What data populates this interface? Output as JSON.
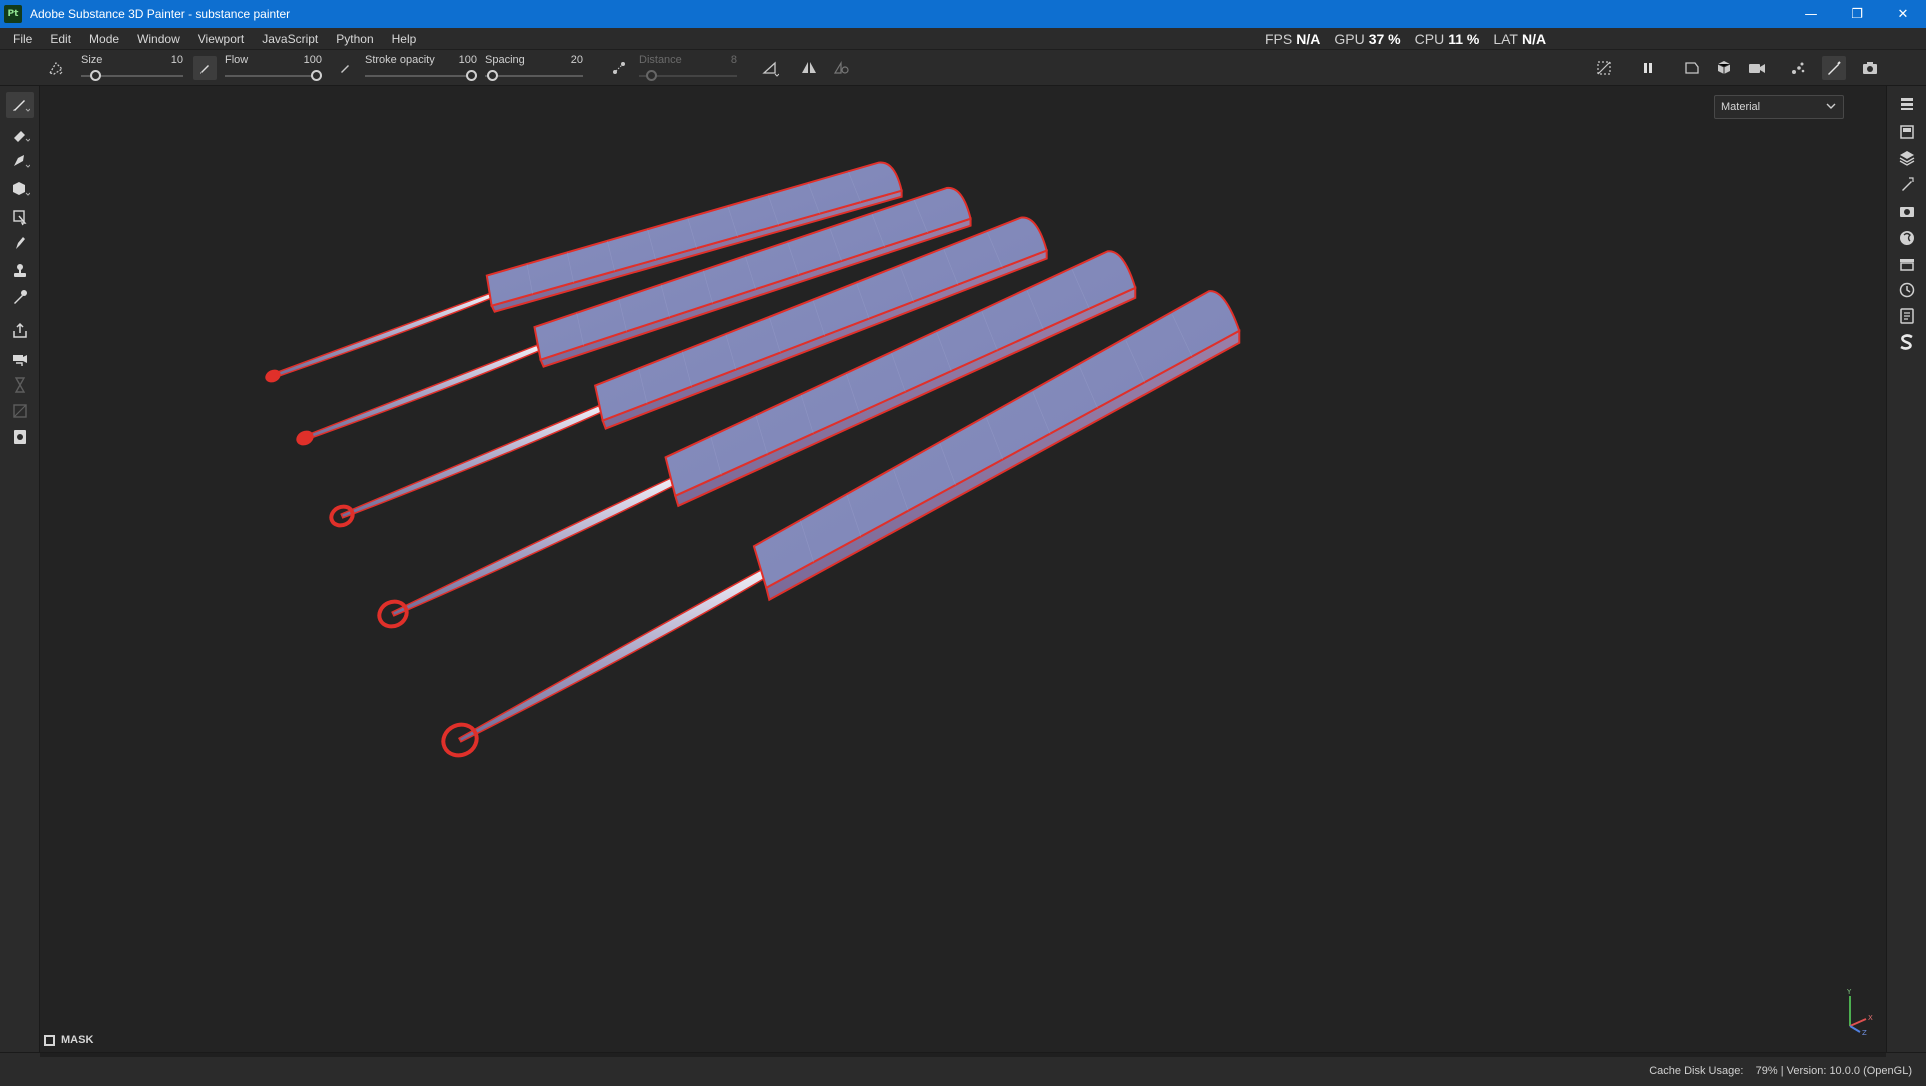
{
  "window": {
    "app_badge": "Pt",
    "title": "Adobe Substance 3D Painter - substance painter",
    "controls": {
      "minimize": "—",
      "restore": "❐",
      "close": "✕"
    }
  },
  "menu": {
    "items": [
      "File",
      "Edit",
      "Mode",
      "Window",
      "Viewport",
      "JavaScript",
      "Python",
      "Help"
    ]
  },
  "perf": {
    "fps_label": "FPS",
    "fps_value": "N/A",
    "gpu_label": "GPU",
    "gpu_value": "37 %",
    "cpu_label": "CPU",
    "cpu_value": "11 %",
    "lat_label": "LAT",
    "lat_value": "N/A"
  },
  "toolbar": {
    "size": {
      "label": "Size",
      "value": "10",
      "level": 0.1
    },
    "flow": {
      "label": "Flow",
      "value": "100",
      "level": 1.0
    },
    "stroke_opacity": {
      "label": "Stroke opacity",
      "value": "100",
      "level": 1.0
    },
    "spacing": {
      "label": "Spacing",
      "value": "20",
      "level": 0.02
    },
    "distance": {
      "label": "Distance",
      "value": "8",
      "level": 0.08,
      "disabled": true
    }
  },
  "left_tools": [
    {
      "name": "paint-brush-tool-icon",
      "active": true
    },
    {
      "name": "eraser-tool-icon"
    },
    {
      "name": "projection-tool-icon"
    },
    {
      "name": "geometry-mask-tool-icon"
    },
    {
      "name": "polygon-fill-tool-icon"
    },
    {
      "name": "smudge-tool-icon"
    },
    {
      "name": "clone-stamp-tool-icon"
    },
    {
      "name": "color-picker-tool-icon"
    },
    {
      "name": "bake-export-icon"
    },
    {
      "name": "iray-render-icon"
    },
    {
      "name": "hourglass-icon",
      "disabled": true
    },
    {
      "name": "uv-tool-icon",
      "disabled": true
    },
    {
      "name": "texture-set-icon"
    }
  ],
  "right_panels": [
    "texture-set-list-icon",
    "texture-set-settings-icon",
    "layers-icon",
    "properties-icon",
    "display-settings-icon",
    "shader-settings-icon",
    "shelf-icon",
    "history-icon",
    "log-icon",
    "substance-icon"
  ],
  "viewport": {
    "mode_select_value": "Material",
    "mask_label": "MASK",
    "object_count": 5,
    "colors": {
      "fill": "#8087b8",
      "edge": "#e0302a",
      "background": "#232323"
    }
  },
  "status": {
    "cache_label": "Cache Disk Usage:",
    "cache_value": "79%",
    "separator": "|",
    "version_text": "Version: 10.0.0 (OpenGL)"
  }
}
